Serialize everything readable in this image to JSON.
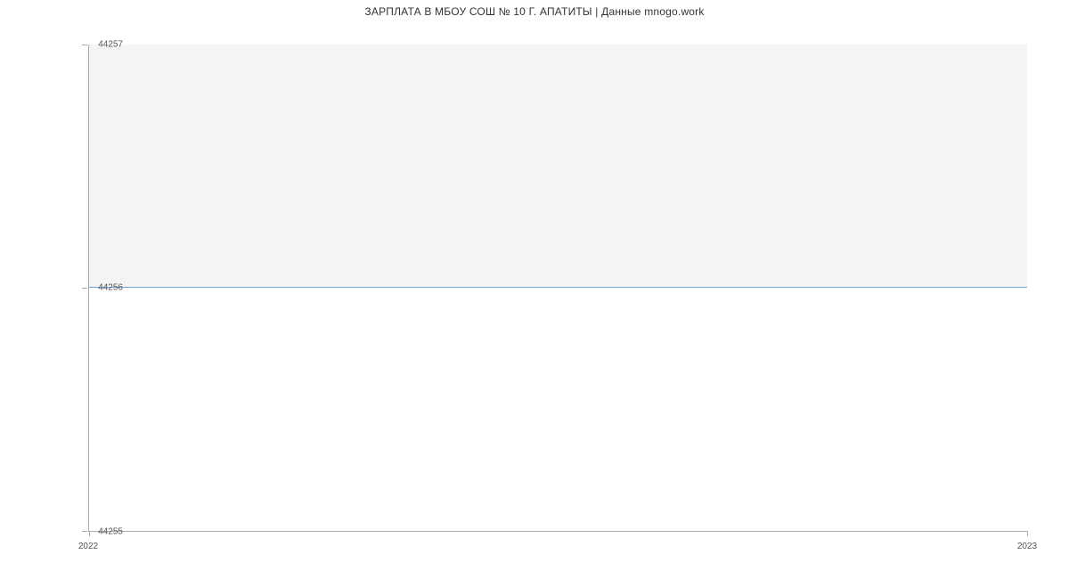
{
  "chart_data": {
    "type": "line",
    "title": "ЗАРПЛАТА В МБОУ СОШ № 10 Г. АПАТИТЫ | Данные mnogo.work",
    "xlabel": "",
    "ylabel": "",
    "x": [
      "2022",
      "2023"
    ],
    "values": [
      44256,
      44256
    ],
    "ylim": [
      44255,
      44257
    ],
    "y_ticks": [
      44255,
      44256,
      44257
    ],
    "x_ticks": [
      "2022",
      "2023"
    ],
    "line_color": "#6f9fd8"
  }
}
